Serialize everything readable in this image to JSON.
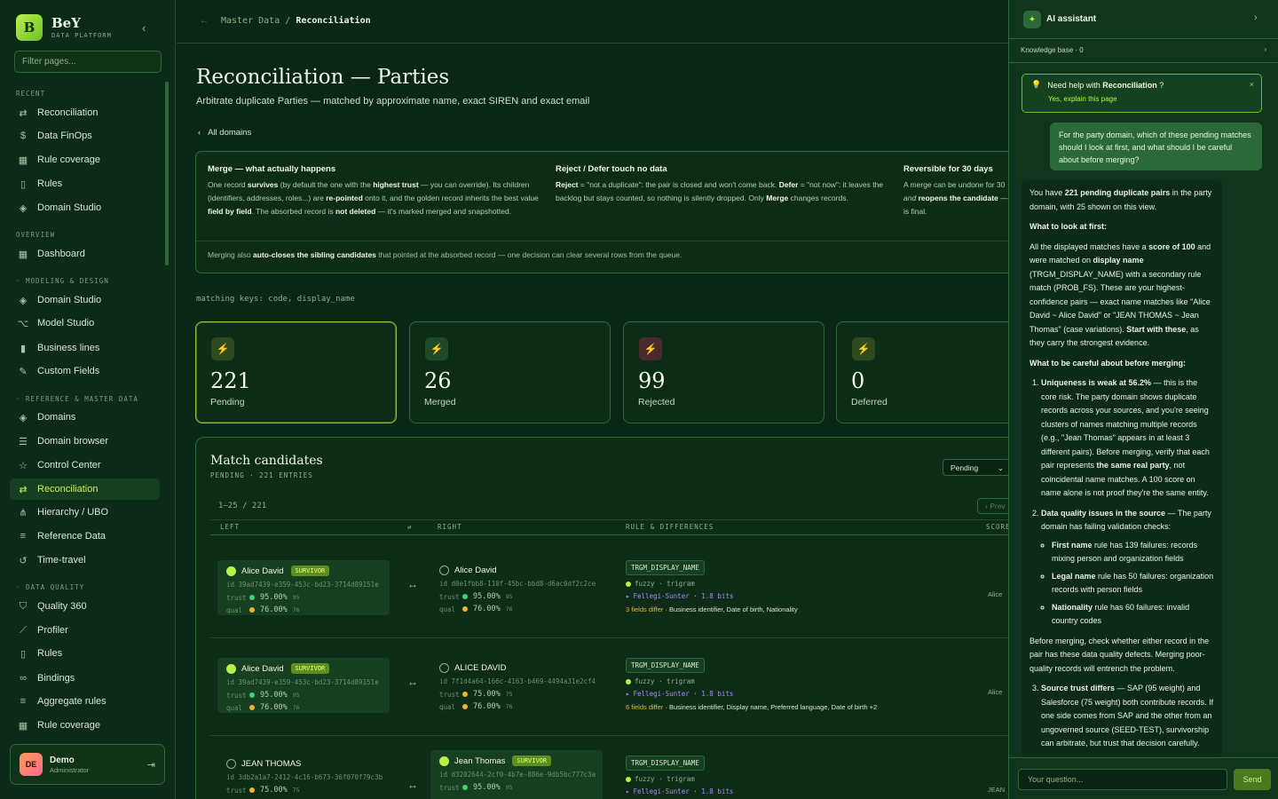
{
  "brand": {
    "name": "BeY",
    "sub": "DATA PLATFORM",
    "initial": "B"
  },
  "sidebar": {
    "filter_placeholder": "Filter pages...",
    "sections": {
      "recent": "RECENT",
      "overview": "OVERVIEW",
      "modeling": "◦ MODELING & DESIGN",
      "reference": "◦ REFERENCE & MASTER DATA",
      "quality": "◦ DATA QUALITY"
    },
    "recent": [
      "Reconciliation",
      "Data FinOps",
      "Rule coverage",
      "Rules",
      "Domain Studio"
    ],
    "overview": [
      "Dashboard"
    ],
    "modeling": [
      "Domain Studio",
      "Model Studio",
      "Business lines",
      "Custom Fields"
    ],
    "reference": [
      "Domains",
      "Domain browser",
      "Control Center",
      "Reconciliation",
      "Hierarchy / UBO",
      "Reference Data",
      "Time-travel"
    ],
    "quality": [
      "Quality 360",
      "Profiler",
      "Rules",
      "Bindings",
      "Aggregate rules",
      "Rule coverage"
    ],
    "user": {
      "initials": "DE",
      "name": "Demo",
      "role": "Administrator"
    }
  },
  "breadcrumb": {
    "parent": "Master Data",
    "sep": "/",
    "current": "Reconciliation"
  },
  "page": {
    "title": "Reconciliation — Parties",
    "subtitle": "Arbitrate duplicate Parties — matched by approximate name, exact SIREN and exact email",
    "back": "All domains",
    "keys": "matching keys: code, display_name"
  },
  "info": {
    "merge_title": "Merge — what actually happens",
    "reject_title": "Reject / Defer touch no data",
    "rev_title": "Reversible for 30 days",
    "footer_a": "Merging also ",
    "footer_b": "auto-closes the sibling candidates",
    "footer_c": " that pointed at the absorbed record — one decision can clear several rows from the queue."
  },
  "stats": [
    {
      "value": "221",
      "label": "Pending"
    },
    {
      "value": "26",
      "label": "Merged"
    },
    {
      "value": "99",
      "label": "Rejected"
    },
    {
      "value": "0",
      "label": "Deferred"
    }
  ],
  "candidates": {
    "title": "Match candidates",
    "sub": "PENDING · 221 ENTRIES",
    "filter": "Pending",
    "range": "1–25 / 221",
    "prev": "‹ Prev",
    "columns": {
      "left": "LEFT",
      "right": "RIGHT",
      "rule": "RULE & DIFFERENCES",
      "score": "SCORE"
    },
    "rows": [
      {
        "left": {
          "name": "Alice David",
          "badge": "SURVIVOR",
          "id": "id 39ad7439-e359-453c-bd23-3714d89151e",
          "trust": "95.00%",
          "trust_n": "95",
          "qual": "76.00%",
          "qual_n": "76"
        },
        "right": {
          "name": "Alice David",
          "id": "id d0e1fbb8-110f-45bc-bbd8-d6ac0df2c2ce",
          "trust": "95.00%",
          "trust_n": "95",
          "qual": "76.00%",
          "qual_n": "76"
        },
        "rule": "TRGM_DISPLAY_NAME",
        "fuzzy": "fuzzy · trigram",
        "fs": "Fellegi-Sunter · 1.8 bits",
        "diff_n": "3 fields differ",
        "diff_t": " · Business identifier, Date of birth, Nationality",
        "score": "Alice"
      },
      {
        "left": {
          "name": "Alice David",
          "badge": "SURVIVOR",
          "id": "id 39ad7439-e359-453c-bd23-3714d89151e",
          "trust": "95.00%",
          "trust_n": "95",
          "qual": "76.00%",
          "qual_n": "76"
        },
        "right": {
          "name": "ALICE DAVID",
          "id": "id 7f1d4a64-166c-4163-b469-4494a31e2cf4",
          "trust": "75.00%",
          "trust_n": "75",
          "qual": "76.00%",
          "qual_n": "76"
        },
        "rule": "TRGM_DISPLAY_NAME",
        "fuzzy": "fuzzy · trigram",
        "fs": "Fellegi-Sunter · 1.8 bits",
        "diff_n": "6 fields differ",
        "diff_t": " · Business identifier, Display name, Preferred language, Date of birth +2",
        "score": "Alice"
      },
      {
        "left": {
          "name": "JEAN THOMAS",
          "id": "id 3db2a1a7-2412-4c16-b673-36f070f79c3b",
          "trust": "75.00%",
          "trust_n": "75"
        },
        "right": {
          "name": "Jean Thomas",
          "badge": "SURVIVOR",
          "id": "id d3202644-2cf0-4b7e-886e-9db5bc777c3a",
          "trust": "95.00%",
          "trust_n": "95"
        },
        "rule": "TRGM_DISPLAY_NAME",
        "fuzzy": "fuzzy · trigram",
        "fs": "Fellegi-Sunter · 1.8 bits",
        "score": "JEAN"
      }
    ]
  },
  "ai": {
    "title": "AI assistant",
    "kb": "Knowledge base · 0",
    "help_q_a": "Need help with ",
    "help_q_b": "Reconciliation",
    "help_q_c": " ?",
    "help_a": "Yes, explain this page",
    "user_msg": "For the party domain, which of these pending matches should I look at first, and what should I be careful about before merging?",
    "placeholder": "Your question...",
    "send": "Send"
  },
  "colors": {
    "accent": "#b9f04a",
    "bg": "#0a2616",
    "trust": "#3fd27a",
    "warn": "#f2b430"
  }
}
